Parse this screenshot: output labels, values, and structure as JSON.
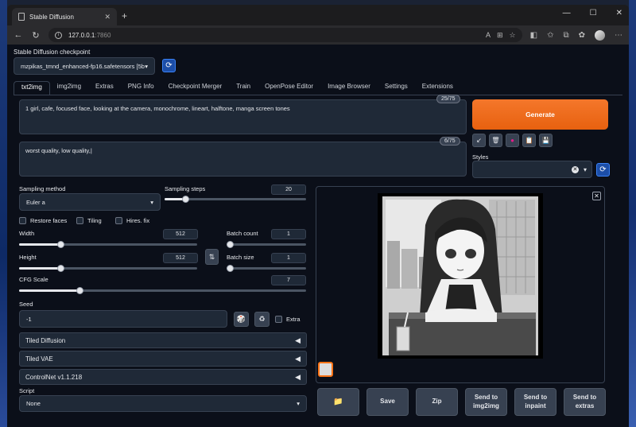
{
  "browser": {
    "tab_title": "Stable Diffusion",
    "url_host": "127.0.0.1",
    "url_port": ":7860"
  },
  "checkpoint": {
    "label": "Stable Diffusion checkpoint",
    "value": "mzpikas_tmnd_enhanced-fp16.safetensors [5b"
  },
  "tabs": [
    "txt2img",
    "img2img",
    "Extras",
    "PNG Info",
    "Checkpoint Merger",
    "Train",
    "OpenPose Editor",
    "Image Browser",
    "Settings",
    "Extensions"
  ],
  "prompt": {
    "positive": "1 girl, cafe, focused face, looking at the camera,  monochrome, lineart,  halftone, manga screen tones",
    "positive_count": "25/75",
    "negative": "worst quality, low quality,|",
    "negative_count": "6/75"
  },
  "generate_label": "Generate",
  "styles": {
    "label": "Styles"
  },
  "params": {
    "sampling_method_label": "Sampling method",
    "sampling_method": "Euler a",
    "sampling_steps_label": "Sampling steps",
    "sampling_steps": "20",
    "restore_faces": "Restore faces",
    "tiling": "Tiling",
    "hires_fix": "Hires. fix",
    "width_label": "Width",
    "width": "512",
    "height_label": "Height",
    "height": "512",
    "batch_count_label": "Batch count",
    "batch_count": "1",
    "batch_size_label": "Batch size",
    "batch_size": "1",
    "cfg_label": "CFG Scale",
    "cfg": "7",
    "seed_label": "Seed",
    "seed": "-1",
    "extra": "Extra"
  },
  "accordions": [
    "Tiled Diffusion",
    "Tiled VAE",
    "ControlNet v1.1.218"
  ],
  "script": {
    "label": "Script",
    "value": "None"
  },
  "output_buttons": {
    "save": "Save",
    "zip": "Zip",
    "send_img2img": "Send to\nimg2img",
    "send_inpaint": "Send to\ninpaint",
    "send_extras": "Send to\nextras"
  }
}
